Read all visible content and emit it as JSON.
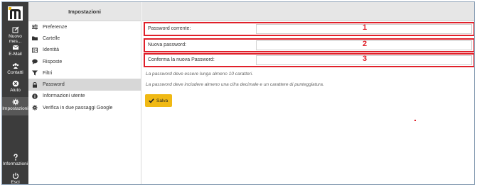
{
  "rail": {
    "items": [
      {
        "label": "Nuovo mes...",
        "icon": "compose-icon"
      },
      {
        "label": "E-Mail",
        "icon": "envelope-icon"
      },
      {
        "label": "Contatti",
        "icon": "contacts-icon"
      },
      {
        "label": "Aiuto",
        "icon": "help-circle-icon"
      },
      {
        "label": "Impostazioni",
        "icon": "gear-icon"
      }
    ],
    "bottom": [
      {
        "label": "Informazioni",
        "icon": "question-icon"
      },
      {
        "label": "Esci",
        "icon": "power-icon"
      }
    ]
  },
  "menu": {
    "title": "Impostazioni",
    "items": [
      {
        "label": "Preferenze",
        "icon": "sliders-icon"
      },
      {
        "label": "Cartelle",
        "icon": "folder-icon"
      },
      {
        "label": "Identità",
        "icon": "id-card-icon"
      },
      {
        "label": "Risposte",
        "icon": "speech-bubble-icon"
      },
      {
        "label": "Filtri",
        "icon": "filter-icon"
      },
      {
        "label": "Password",
        "icon": "lock-icon"
      },
      {
        "label": "Informazioni utente",
        "icon": "info-icon"
      },
      {
        "label": "Verifica in due passaggi Google",
        "icon": "gear-icon"
      }
    ]
  },
  "form": {
    "rows": [
      {
        "label": "Password corrente:",
        "value": "",
        "marker": "1"
      },
      {
        "label": "Nuova password:",
        "value": "",
        "marker": "2"
      },
      {
        "label": "Conferma la nuova Password:",
        "value": "",
        "marker": "3"
      }
    ],
    "note1": "La password deve essere lunga almeno 10 caratteri.",
    "note2": "La password deve includere almeno una cifra decimale e un carattere di punteggiatura.",
    "save_label": "Salva"
  },
  "colors": {
    "rail": "#3c3c3c",
    "highlight_border": "#e0202a",
    "save_button": "#f0b914",
    "header_bg": "#e6e6e6"
  }
}
